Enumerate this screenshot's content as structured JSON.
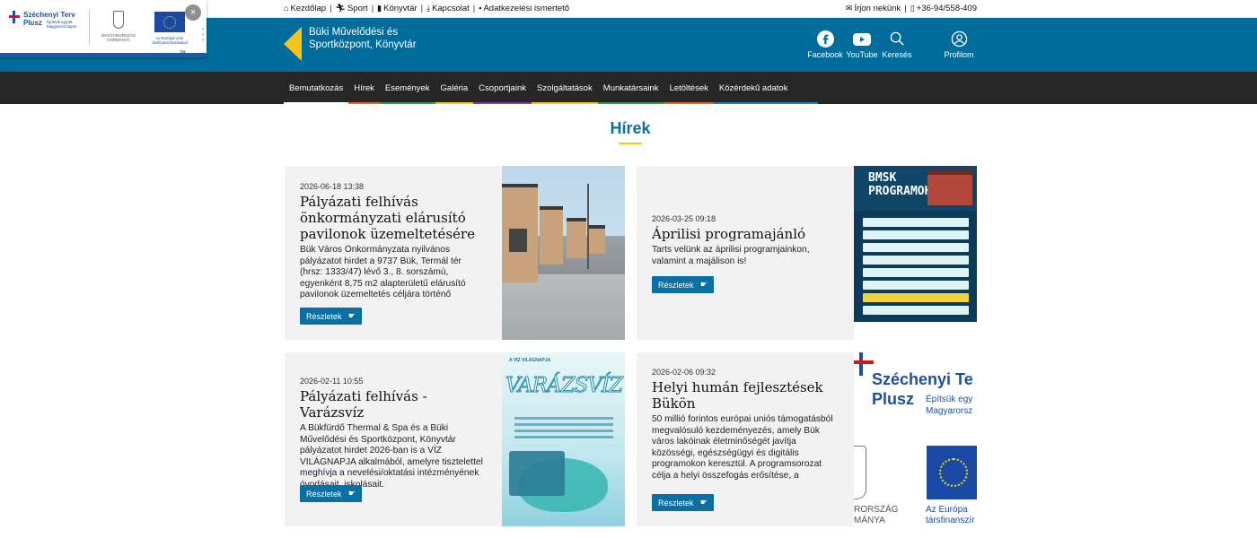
{
  "topbar": {
    "links": [
      {
        "label": "Kezdőlap",
        "icon": "home-icon"
      },
      {
        "label": "Sport",
        "icon": "runner-icon"
      },
      {
        "label": "Könyvtár",
        "icon": "book-icon"
      },
      {
        "label": "Kapcsolat",
        "icon": "download-icon"
      },
      {
        "label": "Adatkezelési ismertető",
        "icon": "document-icon"
      }
    ],
    "contact": [
      {
        "label": "Írjon nekünk",
        "icon": "envelope-icon"
      },
      {
        "label": "+36-94/558-409",
        "icon": "phone-icon"
      }
    ]
  },
  "header": {
    "logo_text": "Büki Művelődési és Sportközpont, Könyvtár",
    "logo_color": "#f5c518",
    "background": "#006c9c",
    "icons": [
      {
        "label": "Facebook",
        "icon": "facebook-icon"
      },
      {
        "label": "YouTube",
        "icon": "youtube-icon"
      },
      {
        "label": "Keresés",
        "icon": "search-icon"
      },
      {
        "label": "Profilom",
        "icon": "user-icon"
      }
    ]
  },
  "nav": {
    "items": [
      {
        "label": "Bemutatkozás",
        "color": "#ffffff"
      },
      {
        "label": "Hírek",
        "color": "#e8632b"
      },
      {
        "label": "Események",
        "color": "#2f9d4a"
      },
      {
        "label": "Galéria",
        "color": "#f5c518"
      },
      {
        "label": "Csoportjaink",
        "color": "#7a3fb3"
      },
      {
        "label": "Szolgáltatások",
        "color": "#f5c518"
      },
      {
        "label": "Munkatársaink",
        "color": "#2f9d4a"
      },
      {
        "label": "Letöltések",
        "color": "#e8632b"
      },
      {
        "label": "Közérdekű adatok",
        "color": "#1f7fc0"
      }
    ]
  },
  "popup": {
    "szt_line1": "Széchenyi Terv",
    "szt_line2": "Plusz",
    "szt_tagline": "Építsük együtt Magyarországot!",
    "gov_text": "MAGYARORSZÁG KORMÁNYA",
    "eu_text": "Az Európai Unió társfinanszírozásával",
    "close": "×",
    "arrows": "›››"
  },
  "main": {
    "title": "Hírek",
    "accent": "#0a6fa2",
    "button_label": "Részletek",
    "articles": [
      {
        "date": "2026-06-18 13:38",
        "title": "Pályázati felhívás önkormányzati elárusító pavilonok üzemeltetésére",
        "excerpt": "Bük Város Önkormányzata nyilvános pályázatot hirdet a 9737 Bük, Termál tér (hrsz: 1333/47) lévő 3., 8. sorszámú, egyenként 8,75 m2 alapterületű elárusító pavilonok üzemeltetés céljára történő"
      },
      {
        "date": "2026-03-25 09:18",
        "title": "Áprilisi programajánló",
        "excerpt": "Tarts velünk az áprilisi programjainkon, valamint a majálison is!",
        "image_text": {
          "line1": "BMSK",
          "line2": "PROGRAMOK"
        }
      },
      {
        "date": "2026-02-11 10:55",
        "title": "Pályázati felhívás - Varázsvíz",
        "excerpt": "A Bükfürdő Thermal & Spa és a Büki Művelődési és Sportközpont, Könyvtár pályázatot hirdet 2026-ban is a VÍZ VILÁGNAPJA alkalmából, amelyre tisztelettel meghívja a nevelési/oktatási intézményének óvodásait, iskolásait.",
        "image_text": {
          "heading": "A VÍZ VILÁGNAPJA",
          "big": "VARÁZSVÍZ"
        }
      },
      {
        "date": "2026-02-06 09:32",
        "title": "Helyi humán fejlesztések Bükön",
        "excerpt": "50 millió forintos európai uniós támogatásból megvalósuló kezdeményezés, amely Bük város lakóinak életminőségét javítja közösségi, egészségügyi és digitális programokon keresztül. A programsorozat célja a helyi összefogás erősítése, a",
        "image_text": {
          "t1": "Széchenyi Te",
          "t2": "Plusz",
          "t3": "Építsük egy Magyarorsz",
          "mk": "RORSZÁG MÁNYA",
          "eu": "Az Európa társfinanszír"
        }
      }
    ]
  }
}
